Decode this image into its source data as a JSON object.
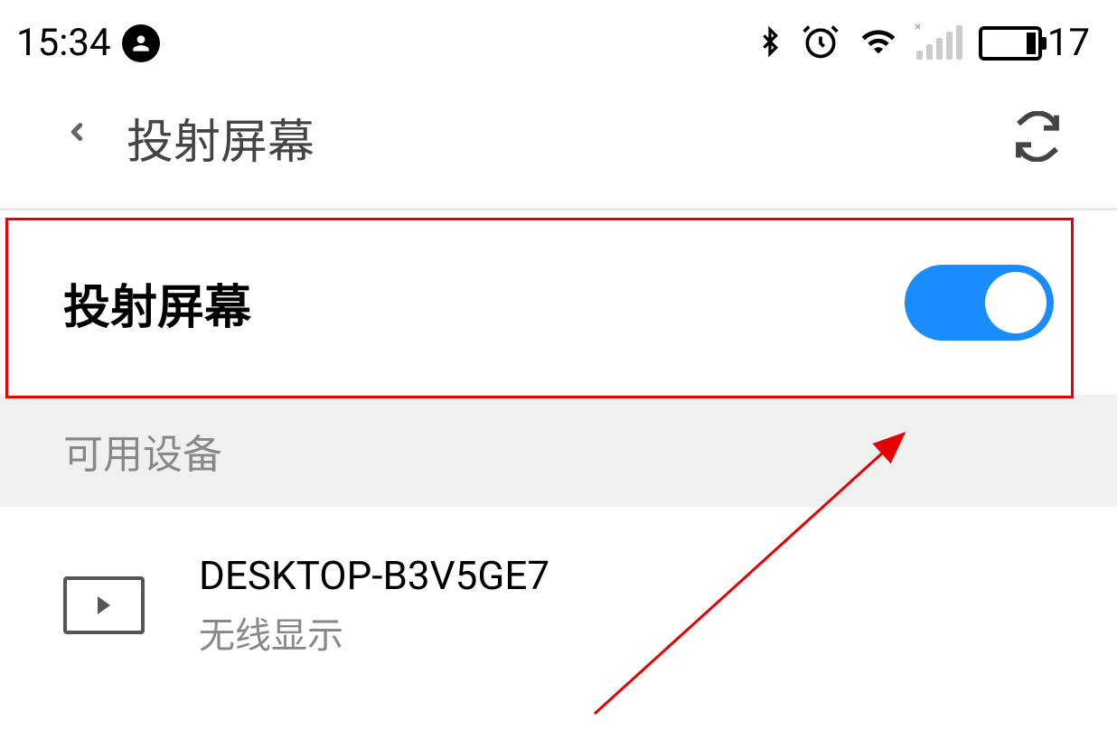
{
  "status_bar": {
    "time": "15:34",
    "battery_level": "17"
  },
  "header": {
    "title": "投射屏幕"
  },
  "toggle": {
    "label": "投射屏幕",
    "enabled": true
  },
  "section": {
    "available_devices": "可用设备"
  },
  "devices": [
    {
      "name": "DESKTOP-B3V5GE7",
      "type": "无线显示"
    }
  ]
}
